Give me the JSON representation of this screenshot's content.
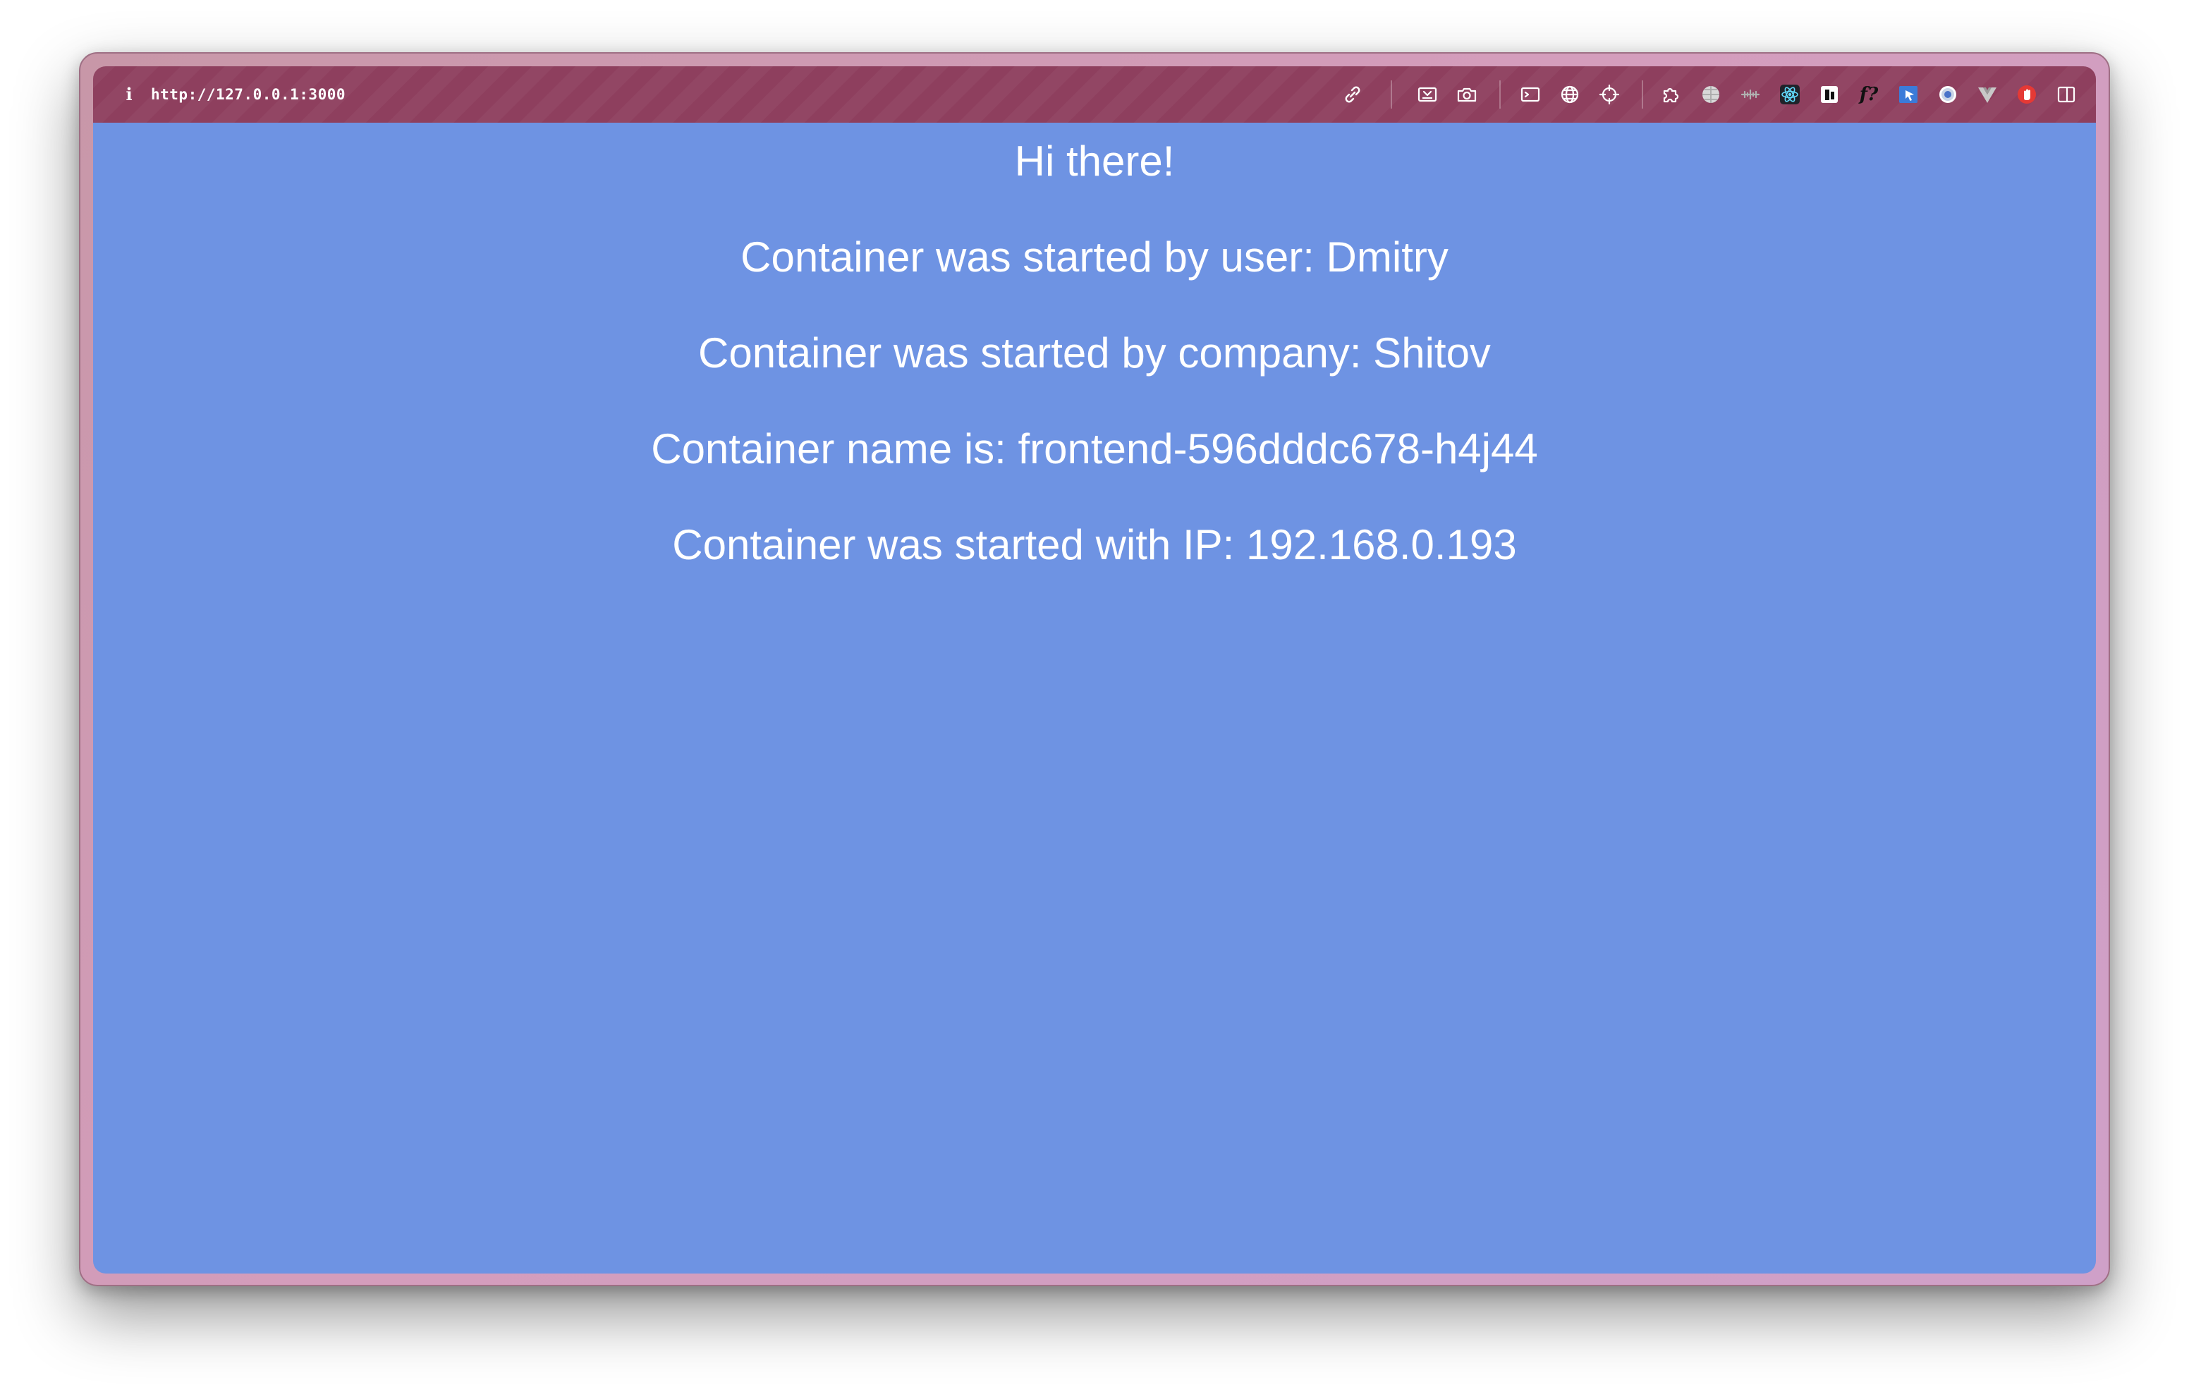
{
  "browser": {
    "url": "http://127.0.0.1:3000",
    "info_icon_text": "i",
    "toolbar_icons": [
      "link-icon",
      "screenshot-area-icon",
      "camera-icon",
      "terminal-icon",
      "globe-icon",
      "crosshair-icon",
      "puzzle-icon",
      "world-icon",
      "ruler-icon",
      "react-icon",
      "notion-icon",
      "function-icon",
      "cursor-icon",
      "chrome-icon",
      "vue-icon",
      "hand-stop-icon",
      "sidebar-icon"
    ],
    "function_icon_text": "f?"
  },
  "page": {
    "greeting": "Hi there!",
    "user_line": "Container was started by user: Dmitry",
    "company_line": "Container was started by company: Shitov",
    "name_line": "Container name is: frontend-596dddc678-h4j44",
    "ip_line": "Container was started with IP: 192.168.0.193"
  },
  "colors": {
    "toolbar": "#8e3f5e",
    "page_background": "#6e93e3",
    "text": "#ffffff"
  }
}
